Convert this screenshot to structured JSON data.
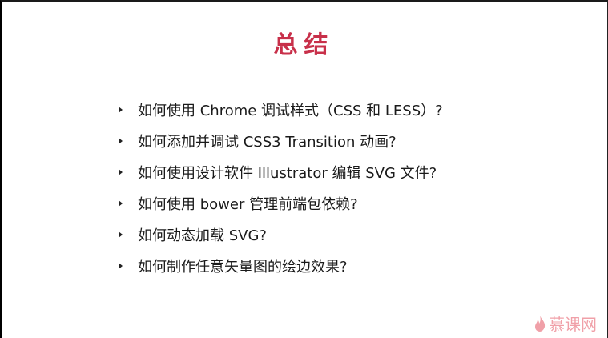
{
  "slide": {
    "title": "总结",
    "items": [
      "如何使用 Chrome 调试样式（CSS 和 LESS）?",
      "如何添加并调试 CSS3 Transition 动画?",
      "如何使用设计软件 Illustrator 编辑 SVG 文件?",
      "如何使用 bower 管理前端包依赖?",
      "如何动态加载 SVG?",
      "如何制作任意矢量图的绘边效果?"
    ],
    "watermark": "慕课网",
    "colors": {
      "title": "#c8304a",
      "watermark": "#f0a0a8"
    }
  }
}
